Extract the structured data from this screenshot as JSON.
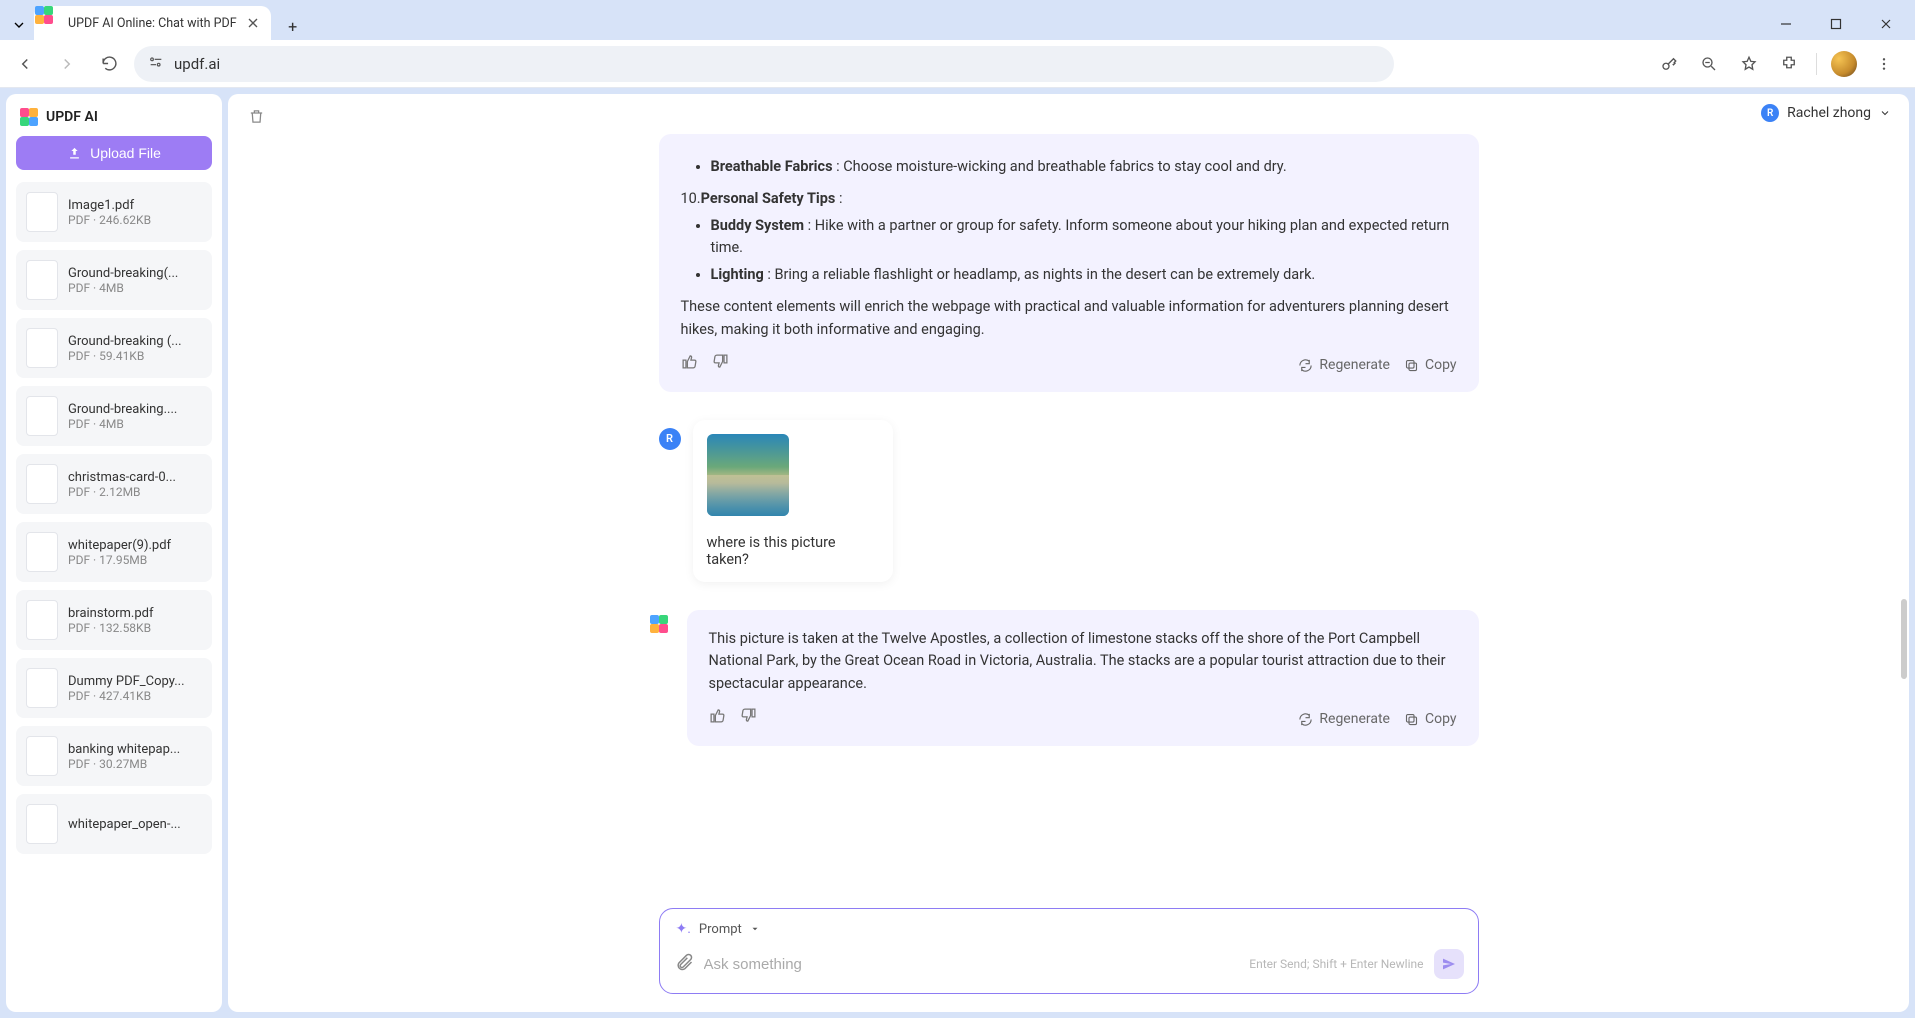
{
  "browser": {
    "tab_title": "UPDF AI Online: Chat with PDF",
    "url": "updf.ai"
  },
  "sidebar": {
    "app_name": "UPDF AI",
    "upload_label": "Upload File",
    "files": [
      {
        "name": "Image1.pdf",
        "meta": "PDF · 246.62KB"
      },
      {
        "name": "Ground-breaking(...",
        "meta": "PDF · 4MB"
      },
      {
        "name": "Ground-breaking (...",
        "meta": "PDF · 59.41KB"
      },
      {
        "name": "Ground-breaking....",
        "meta": "PDF · 4MB"
      },
      {
        "name": "christmas-card-0...",
        "meta": "PDF · 2.12MB"
      },
      {
        "name": "whitepaper(9).pdf",
        "meta": "PDF · 17.95MB"
      },
      {
        "name": "brainstorm.pdf",
        "meta": "PDF · 132.58KB"
      },
      {
        "name": "Dummy PDF_Copy...",
        "meta": "PDF · 427.41KB"
      },
      {
        "name": "banking whitepap...",
        "meta": "PDF · 30.27MB"
      },
      {
        "name": "whitepaper_open-...",
        "meta": ""
      }
    ]
  },
  "header": {
    "user_name": "Rachel zhong",
    "user_initial": "R"
  },
  "chat": {
    "ai1": {
      "bullet_breathable_label": "Breathable Fabrics",
      "bullet_breathable_text": " : Choose moisture-wicking and breathable fabrics to stay cool and dry.",
      "section10_num": "10.",
      "section10_title": "Personal Safety Tips",
      "section10_colon": " :",
      "bullet_buddy_label": "Buddy System",
      "bullet_buddy_text": " : Hike with a partner or group for safety. Inform someone about your hiking plan and expected return time.",
      "bullet_lighting_label": "Lighting",
      "bullet_lighting_text": " : Bring a reliable flashlight or headlamp, as nights in the desert can be extremely dark.",
      "closing": "These content elements will enrich the webpage with practical and valuable information for adventurers planning desert hikes, making it both informative and engaging."
    },
    "user1": {
      "initial": "R",
      "text": "where is this picture taken?"
    },
    "ai2": {
      "text": "This picture is taken at the Twelve Apostles, a collection of limestone stacks off the shore of the Port Campbell National Park, by the Great Ocean Road in Victoria, Australia. The stacks are a popular tourist attraction due to their spectacular appearance."
    },
    "actions": {
      "regenerate": "Regenerate",
      "copy": "Copy"
    }
  },
  "input": {
    "prompt_label": "Prompt",
    "placeholder": "Ask something",
    "hint": "Enter Send; Shift + Enter Newline"
  }
}
